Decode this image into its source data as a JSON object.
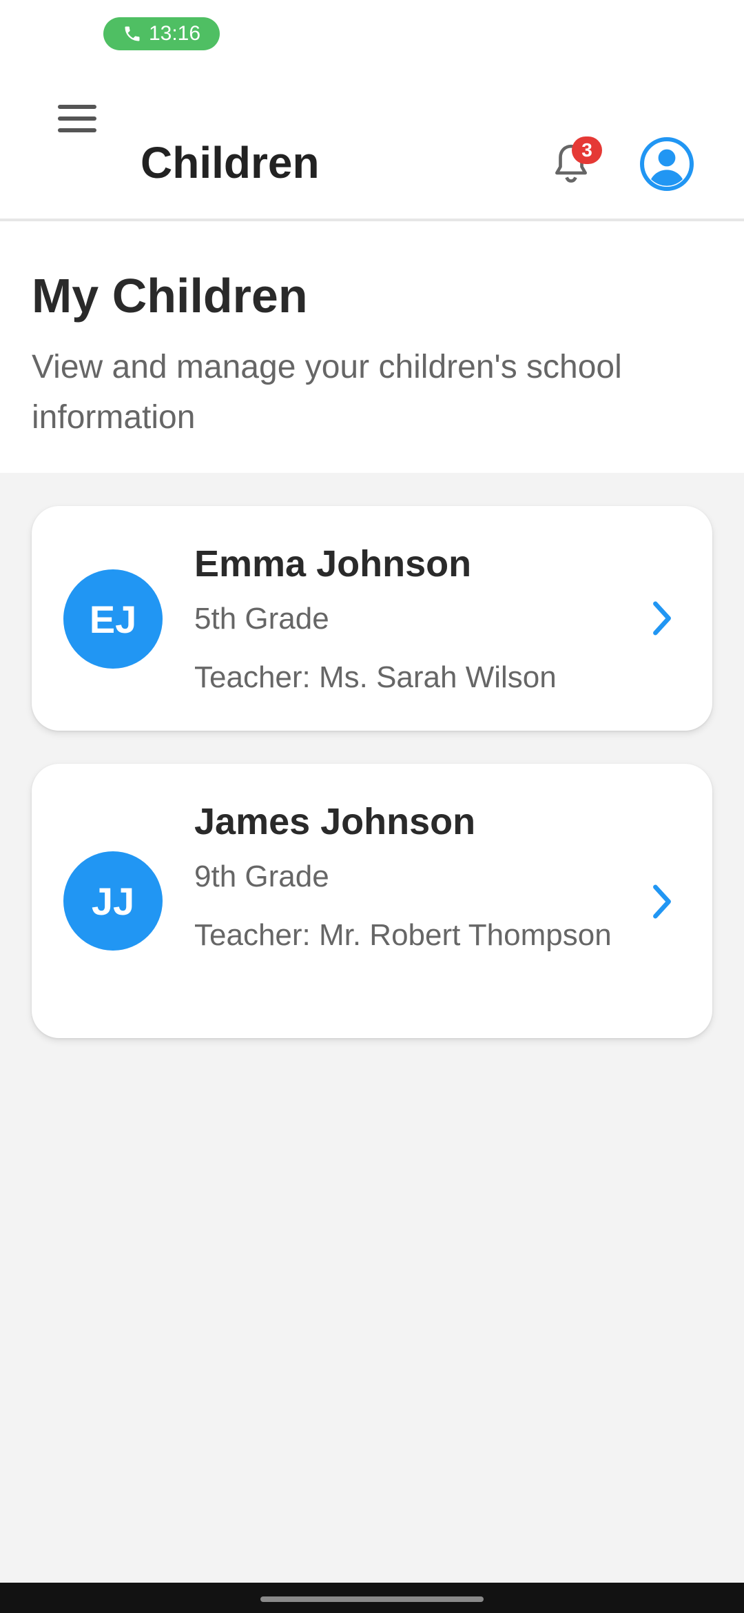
{
  "status_bar": {
    "time": "13:16",
    "call_icon": "phone-icon",
    "pill_color": "#4fbf63"
  },
  "app_bar": {
    "title": "Children",
    "menu_icon": "hamburger-menu-icon",
    "notifications": {
      "icon": "bell-icon",
      "count": "3",
      "badge_color": "#e53935"
    },
    "profile_icon": "account-circle-icon"
  },
  "header": {
    "title": "My Children",
    "subtitle": "View and manage your children's school information"
  },
  "children": [
    {
      "initials": "EJ",
      "name": "Emma Johnson",
      "grade": "5th Grade",
      "teacher": "Teacher: Ms. Sarah Wilson"
    },
    {
      "initials": "JJ",
      "name": "James Johnson",
      "grade": "9th Grade",
      "teacher": "Teacher: Mr. Robert Thompson"
    }
  ],
  "colors": {
    "accent": "#2196f3",
    "background": "#f3f3f3",
    "surface": "#ffffff"
  }
}
